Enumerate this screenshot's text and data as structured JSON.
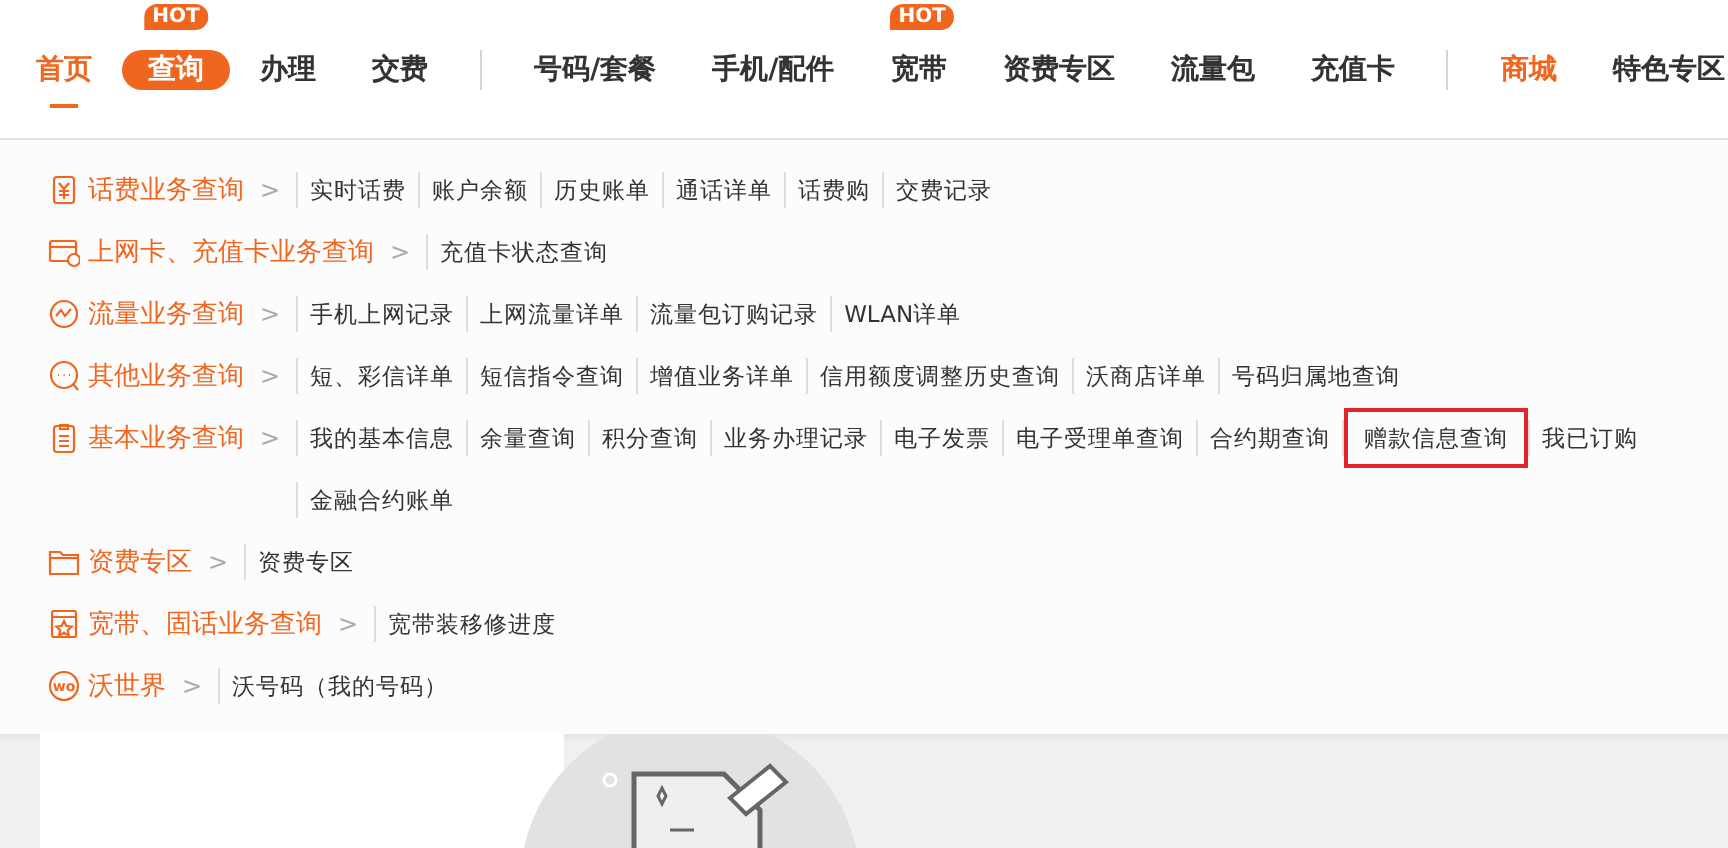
{
  "nav": [
    {
      "items": [
        {
          "label": "首页",
          "kind": "current"
        },
        {
          "label": "查询",
          "kind": "open",
          "badge": "HOT"
        },
        {
          "label": "办理",
          "kind": "plain"
        },
        {
          "label": "交费",
          "kind": "plain"
        }
      ]
    },
    {
      "items": [
        {
          "label": "号码/套餐",
          "kind": "plain"
        },
        {
          "label": "手机/配件",
          "kind": "plain"
        },
        {
          "label": "宽带",
          "kind": "plain",
          "badge": "HOT"
        },
        {
          "label": "资费专区",
          "kind": "plain"
        },
        {
          "label": "流量包",
          "kind": "plain"
        },
        {
          "label": "充值卡",
          "kind": "plain"
        }
      ]
    },
    {
      "items": [
        {
          "label": "商城",
          "kind": "accent"
        },
        {
          "label": "特色专区",
          "kind": "plain"
        }
      ]
    }
  ],
  "menu": [
    {
      "kind": "fee",
      "title": "话费业务查询",
      "arrow": ">",
      "links": [
        {
          "label": "实时话费",
          "highlighted": false
        },
        {
          "label": "账户余额",
          "highlighted": false
        },
        {
          "label": "历史账单",
          "highlighted": false
        },
        {
          "label": "通话详单",
          "highlighted": false
        },
        {
          "label": "话费购",
          "highlighted": false
        },
        {
          "label": "交费记录",
          "highlighted": false
        }
      ]
    },
    {
      "kind": "card",
      "title": "上网卡、充值卡业务查询",
      "arrow": ">",
      "links": [
        {
          "label": "充值卡状态查询",
          "highlighted": false
        }
      ]
    },
    {
      "kind": "traffic",
      "title": "流量业务查询",
      "arrow": ">",
      "links": [
        {
          "label": "手机上网记录",
          "highlighted": false
        },
        {
          "label": "上网流量详单",
          "highlighted": false
        },
        {
          "label": "流量包订购记录",
          "highlighted": false
        },
        {
          "label": "WLAN详单",
          "highlighted": false
        }
      ]
    },
    {
      "kind": "chat",
      "title": "其他业务查询",
      "arrow": ">",
      "links": [
        {
          "label": "短、彩信详单",
          "highlighted": false
        },
        {
          "label": "短信指令查询",
          "highlighted": false
        },
        {
          "label": "增值业务详单",
          "highlighted": false
        },
        {
          "label": "信用额度调整历史查询",
          "highlighted": false
        },
        {
          "label": "沃商店详单",
          "highlighted": false
        },
        {
          "label": "号码归属地查询",
          "highlighted": false
        }
      ]
    },
    {
      "kind": "doc",
      "title": "基本业务查询",
      "arrow": ">",
      "links": [
        {
          "label": "我的基本信息",
          "highlighted": false
        },
        {
          "label": "余量查询",
          "highlighted": false
        },
        {
          "label": "积分查询",
          "highlighted": false
        },
        {
          "label": "业务办理记录",
          "highlighted": false
        },
        {
          "label": "电子发票",
          "highlighted": false
        },
        {
          "label": "电子受理单查询",
          "highlighted": false
        },
        {
          "label": "合约期查询",
          "highlighted": false
        },
        {
          "label": "赠款信息查询",
          "highlighted": true
        },
        {
          "label": "我已订购",
          "highlighted": false
        },
        {
          "label": "金融合约账单",
          "highlighted": false
        }
      ]
    },
    {
      "kind": "folder",
      "title": "资费专区",
      "arrow": ">",
      "links": [
        {
          "label": "资费专区",
          "highlighted": false
        }
      ]
    },
    {
      "kind": "broadband",
      "title": "宽带、固话业务查询",
      "arrow": ">",
      "links": [
        {
          "label": "宽带装移修进度",
          "highlighted": false
        }
      ]
    },
    {
      "kind": "wo",
      "icon_label": "wo",
      "title": "沃世界",
      "arrow": ">",
      "links": [
        {
          "label": "沃号码（我的号码）",
          "highlighted": false
        }
      ]
    }
  ]
}
